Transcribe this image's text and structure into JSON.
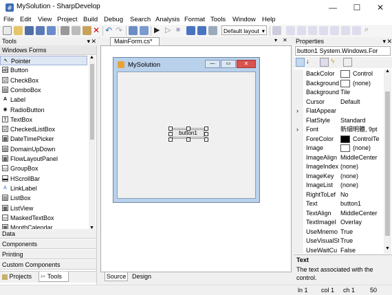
{
  "window": {
    "title": "MySolution - SharpDevelop",
    "minimize": "—",
    "maximize": "☐",
    "close": "✕"
  },
  "menu": [
    "File",
    "Edit",
    "View",
    "Project",
    "Build",
    "Debug",
    "Search",
    "Analysis",
    "Format",
    "Tools",
    "Window",
    "Help"
  ],
  "toolbar": {
    "layout_dropdown": "Default layout"
  },
  "tools_pane": {
    "title": "Tools",
    "category": "Windows Forms",
    "items": [
      "Pointer",
      "Button",
      "CheckBox",
      "ComboBox",
      "Label",
      "RadioButton",
      "TextBox",
      "CheckedListBox",
      "DateTimePicker",
      "DomainUpDown",
      "FlowLayoutPanel",
      "GroupBox",
      "HScrollBar",
      "LinkLabel",
      "ListBox",
      "ListView",
      "MaskedTextBox",
      "MonthCalendar"
    ],
    "item_icons": [
      "↖",
      "ab",
      "☑",
      "▤",
      "A",
      "◉",
      "T",
      "☑",
      "▦",
      "▤",
      "▦",
      "▭",
      "▬",
      "A",
      "▤",
      "▦",
      "▭",
      "▦"
    ],
    "categories": [
      "Data",
      "Components",
      "Printing",
      "Custom Components"
    ],
    "bottom_tabs": [
      "Projects",
      "Tools"
    ]
  },
  "editor": {
    "tab": "MainForm.cs*",
    "form_title": "MySolution",
    "button_label": "button1",
    "bottom_tabs": [
      "Source",
      "Design"
    ]
  },
  "properties": {
    "title": "Properties",
    "object": "button1  System.Windows.For",
    "rows": [
      {
        "name": "BackColor",
        "value": "Control",
        "swatch": "#ffffff",
        "expand": false
      },
      {
        "name": "Background",
        "value": "(none)",
        "swatch": "#ffffff",
        "expand": false
      },
      {
        "name": "Background",
        "value": "Tile",
        "swatch": null,
        "expand": false
      },
      {
        "name": "Cursor",
        "value": "Default",
        "swatch": null,
        "expand": false
      },
      {
        "name": "FlatAppear",
        "value": "",
        "swatch": null,
        "expand": true
      },
      {
        "name": "FlatStyle",
        "value": "Standard",
        "swatch": null,
        "expand": false
      },
      {
        "name": "Font",
        "value": "新細明體, 9pt",
        "swatch": null,
        "expand": true
      },
      {
        "name": "ForeColor",
        "value": "ControlTe",
        "swatch": "#000000",
        "expand": false
      },
      {
        "name": "Image",
        "value": "(none)",
        "swatch": "#ffffff",
        "expand": false
      },
      {
        "name": "ImageAlign",
        "value": "MiddleCenter",
        "swatch": null,
        "expand": false
      },
      {
        "name": "ImageIndex",
        "value": "(none)",
        "swatch": null,
        "expand": false
      },
      {
        "name": "ImageKey",
        "value": "(none)",
        "swatch": null,
        "expand": false
      },
      {
        "name": "ImageList",
        "value": "(none)",
        "swatch": null,
        "expand": false
      },
      {
        "name": "RightToLef",
        "value": "No",
        "swatch": null,
        "expand": false
      },
      {
        "name": "Text",
        "value": "button1",
        "swatch": null,
        "expand": false
      },
      {
        "name": "TextAlign",
        "value": "MiddleCenter",
        "swatch": null,
        "expand": false
      },
      {
        "name": "TextImageI",
        "value": "Overlay",
        "swatch": null,
        "expand": false
      },
      {
        "name": "UseMnemo",
        "value": "True",
        "swatch": null,
        "expand": false
      },
      {
        "name": "UseVisualSt",
        "value": "True",
        "swatch": null,
        "expand": false
      },
      {
        "name": "UseWaitCu",
        "value": "False",
        "swatch": null,
        "expand": false
      }
    ],
    "help_title": "Text",
    "help_text": "The text associated with the control."
  },
  "status": {
    "ln": "ln 1",
    "col": "col 1",
    "ch": "ch 1",
    "zoom": "50"
  }
}
